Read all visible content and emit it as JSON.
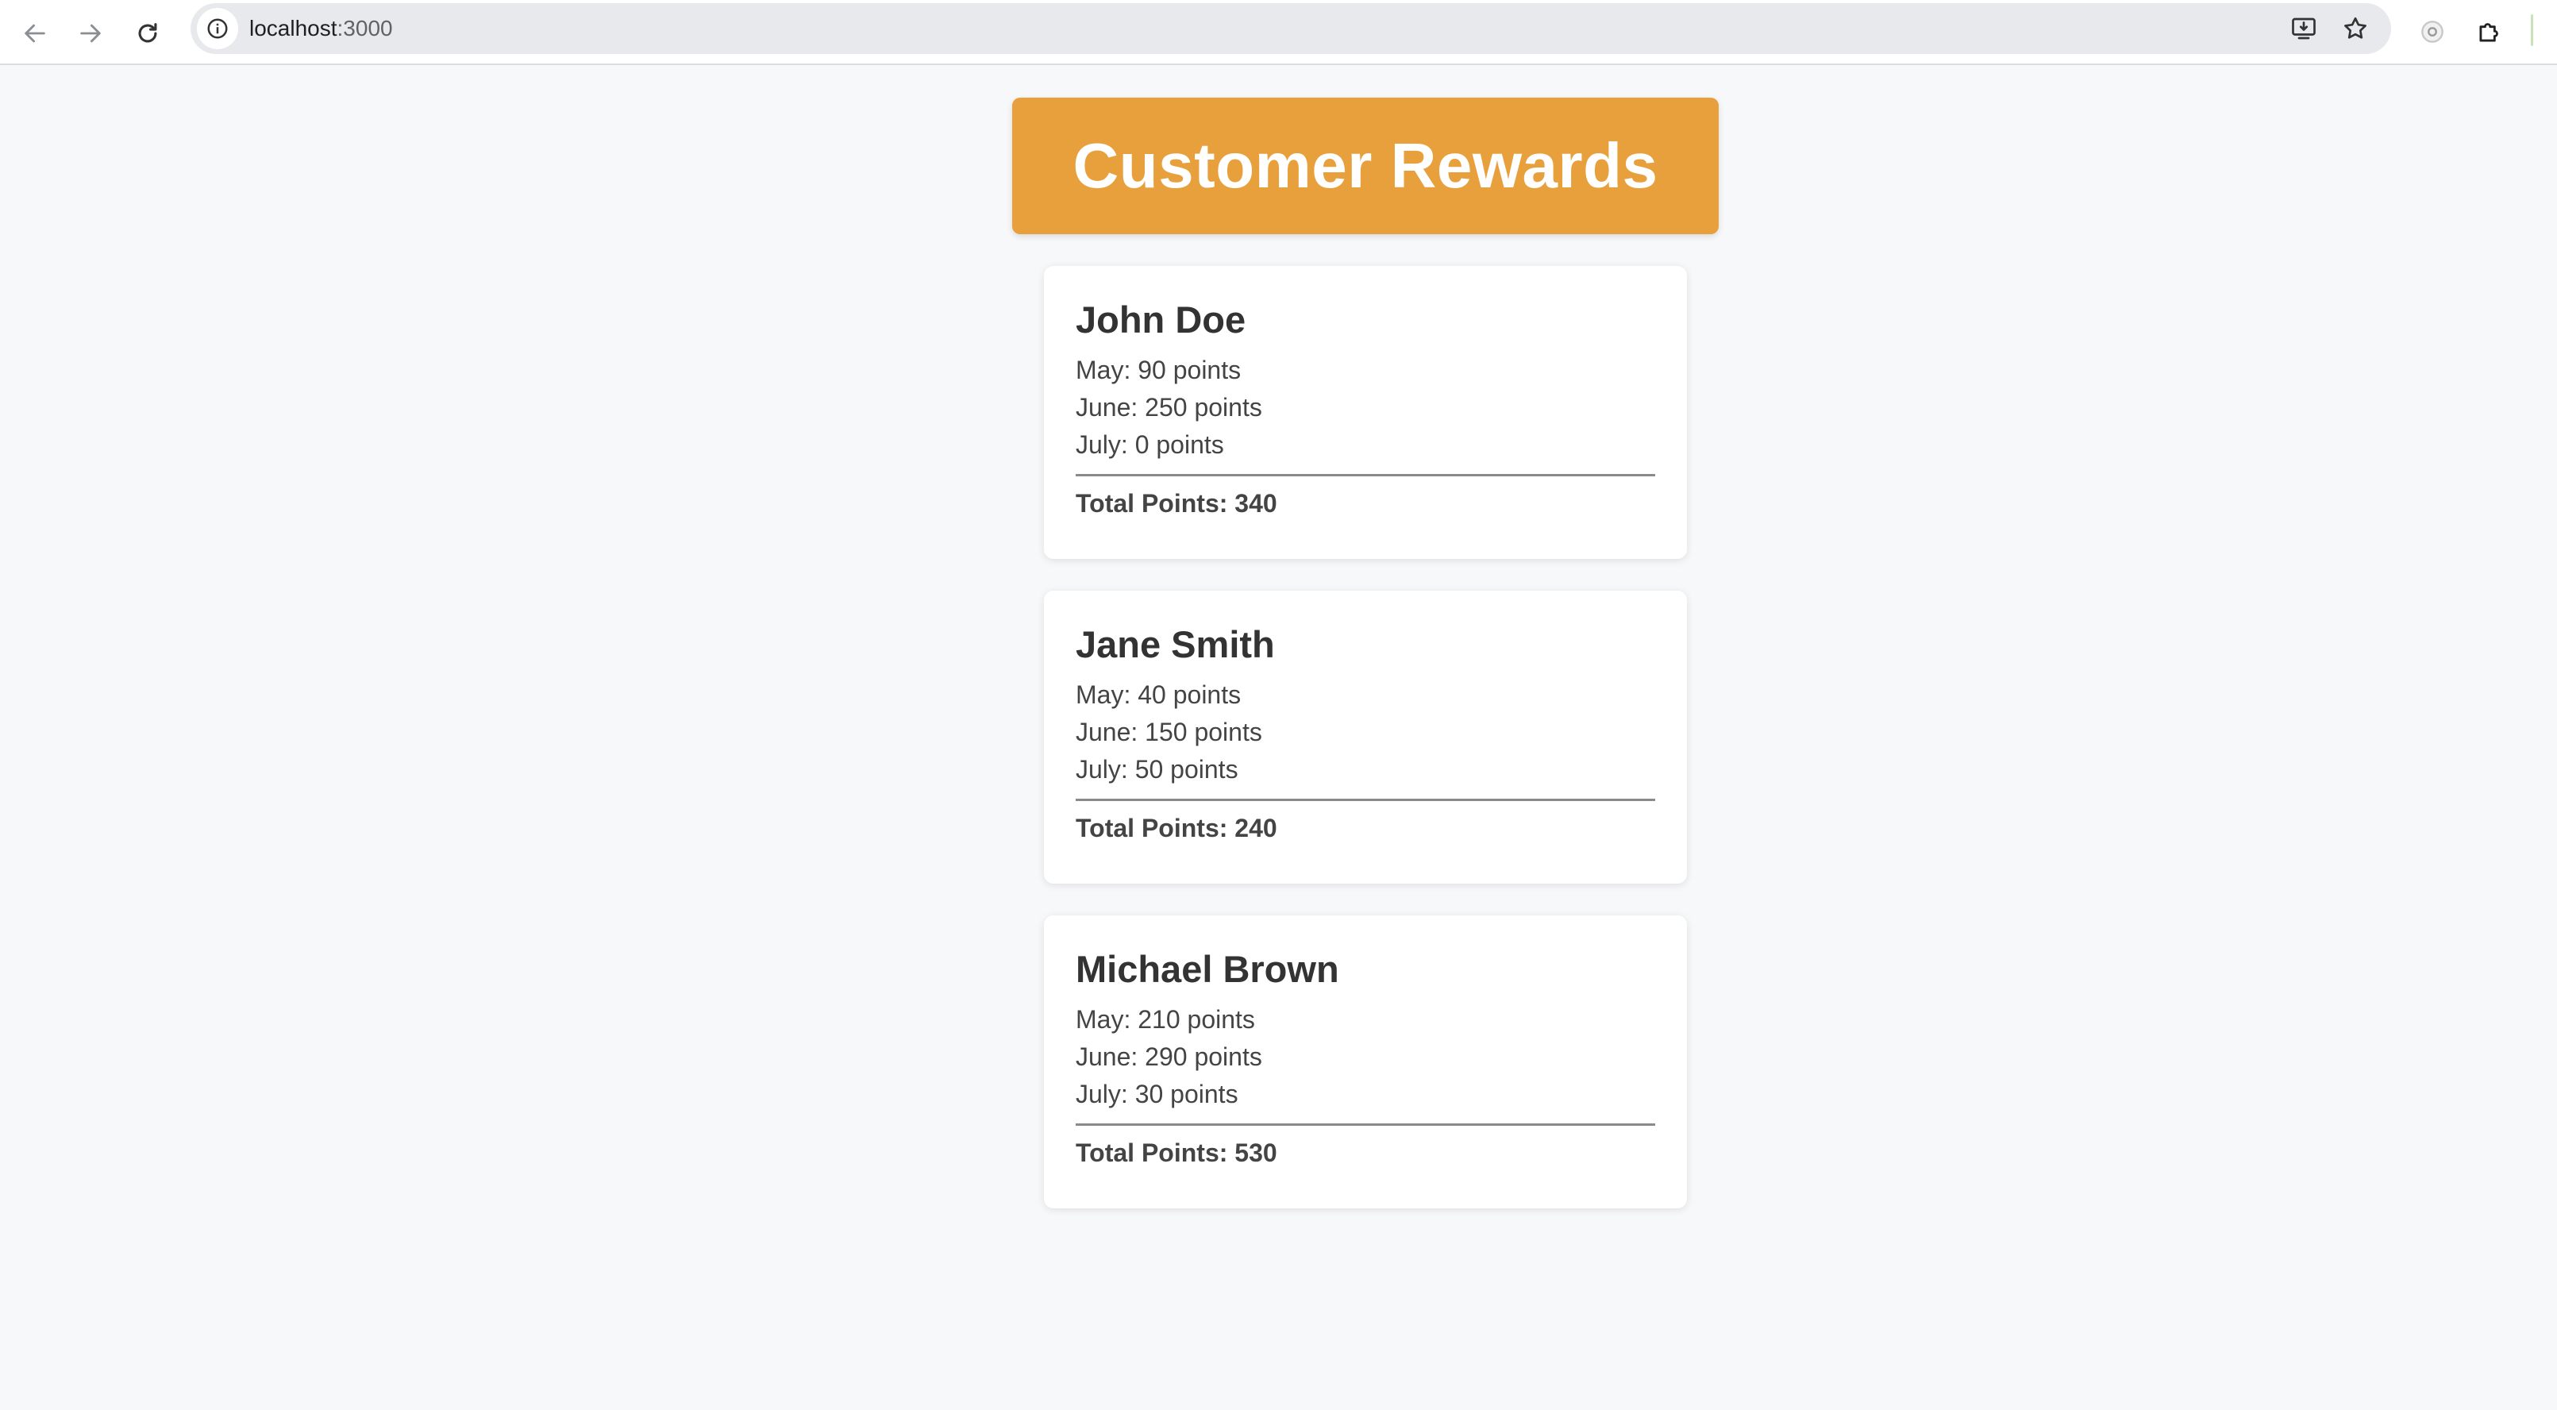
{
  "browser": {
    "url_host": "localhost",
    "url_port": ":3000",
    "icons": {
      "back": "arrow-left-icon",
      "forward": "arrow-right-icon",
      "reload": "reload-icon",
      "site_info": "info-circle-icon",
      "install": "install-app-icon",
      "bookmark": "star-icon",
      "profile": "profile-icon",
      "extensions": "puzzle-icon"
    }
  },
  "header": {
    "title": "Customer Rewards",
    "background_color": "#e7a03c"
  },
  "customers": [
    {
      "name": "John Doe",
      "months": [
        "May: 90 points",
        "June: 250 points",
        "July: 0 points"
      ],
      "total": "Total Points: 340"
    },
    {
      "name": "Jane Smith",
      "months": [
        "May: 40 points",
        "June: 150 points",
        "July: 50 points"
      ],
      "total": "Total Points: 240"
    },
    {
      "name": "Michael Brown",
      "months": [
        "May: 210 points",
        "June: 290 points",
        "July: 30 points"
      ],
      "total": "Total Points: 530"
    }
  ]
}
